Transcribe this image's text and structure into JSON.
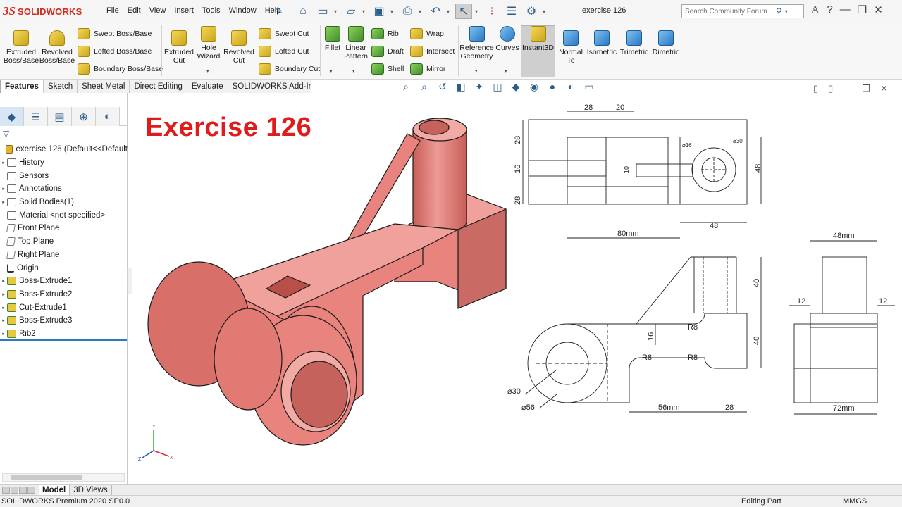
{
  "app": {
    "logo_prefix": "3S",
    "logo_name": "SOLIDWORKS",
    "document_title": "exercise 126"
  },
  "menu": [
    "File",
    "Edit",
    "View",
    "Insert",
    "Tools",
    "Window",
    "Help"
  ],
  "search": {
    "placeholder": "Search Community Forum"
  },
  "commands": {
    "extruded_boss": "Extruded Boss/Base",
    "revolved_boss": "Revolved Boss/Base",
    "swept_boss": "Swept Boss/Base",
    "lofted_boss": "Lofted Boss/Base",
    "boundary_boss": "Boundary Boss/Base",
    "extruded_cut": "Extruded Cut",
    "hole_wizard": "Hole Wizard",
    "revolved_cut": "Revolved Cut",
    "swept_cut": "Swept Cut",
    "lofted_cut": "Lofted Cut",
    "boundary_cut": "Boundary Cut",
    "fillet": "Fillet",
    "linear_pattern": "Linear Pattern",
    "rib": "Rib",
    "draft": "Draft",
    "shell": "Shell",
    "wrap": "Wrap",
    "intersect": "Intersect",
    "mirror": "Mirror",
    "reference_geometry": "Reference Geometry",
    "curves": "Curves",
    "instant3d": "Instant3D",
    "normal_to": "Normal To",
    "isometric": "Isometric",
    "trimetric": "Trimetric",
    "dimetric": "Dimetric"
  },
  "tabs": [
    "Features",
    "Sketch",
    "Sheet Metal",
    "Direct Editing",
    "Evaluate",
    "SOLIDWORKS Add-Ins"
  ],
  "tree": {
    "root": "exercise 126  (Default<<Default",
    "items": [
      {
        "label": "History",
        "icon": "history-icon"
      },
      {
        "label": "Sensors",
        "icon": "sensors-icon"
      },
      {
        "label": "Annotations",
        "icon": "annotations-icon"
      },
      {
        "label": "Solid Bodies(1)",
        "icon": "solid-bodies-icon"
      },
      {
        "label": "Material <not specified>",
        "icon": "material-icon"
      },
      {
        "label": "Front Plane",
        "icon": "plane-icon"
      },
      {
        "label": "Top Plane",
        "icon": "plane-icon"
      },
      {
        "label": "Right Plane",
        "icon": "plane-icon"
      },
      {
        "label": "Origin",
        "icon": "origin-icon"
      },
      {
        "label": "Boss-Extrude1",
        "icon": "extrude-icon"
      },
      {
        "label": "Boss-Extrude2",
        "icon": "extrude-icon"
      },
      {
        "label": "Cut-Extrude1",
        "icon": "cut-icon"
      },
      {
        "label": "Boss-Extrude3",
        "icon": "extrude-icon"
      },
      {
        "label": "Rib2",
        "icon": "rib-icon"
      }
    ]
  },
  "bottom_tabs": [
    "Model",
    "3D Views"
  ],
  "status": {
    "version": "SOLIDWORKS Premium 2020 SP0.0",
    "mode": "Editing Part",
    "units": "MMGS"
  },
  "canvas": {
    "title": "Exercise 126",
    "triad": {
      "y": "Y",
      "x": "X",
      "z": "Z"
    },
    "top_view_dims": [
      "28",
      "20",
      "28",
      "16",
      "28",
      "⌀16",
      "⌀30",
      "10",
      "48",
      "80mm",
      "48"
    ],
    "front_view_dims": [
      "40",
      "40",
      "R8",
      "16",
      "R8",
      "R8",
      "⌀30",
      "⌀56",
      "56mm",
      "28"
    ],
    "side_view_dims": [
      "48mm",
      "12",
      "12",
      "72mm"
    ]
  },
  "colors": {
    "part_face": "#e8837e",
    "part_dark": "#c05a55",
    "title_red": "#e01b1b"
  }
}
